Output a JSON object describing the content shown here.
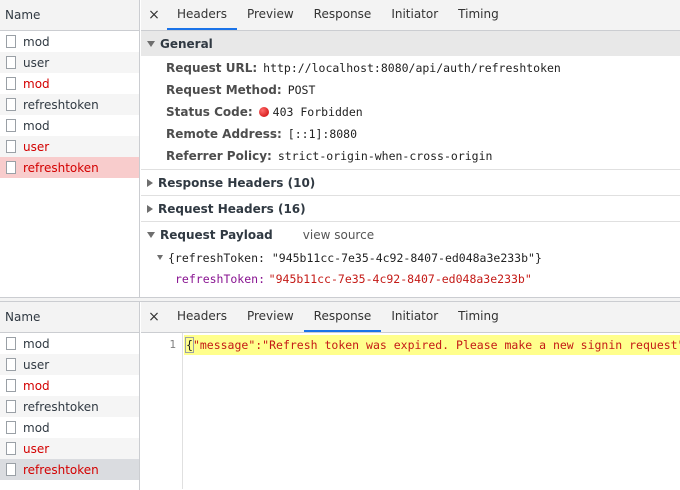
{
  "name_header": "Name",
  "requests": [
    {
      "name": "mod",
      "status": "ok"
    },
    {
      "name": "user",
      "status": "ok"
    },
    {
      "name": "mod",
      "status": "error"
    },
    {
      "name": "refreshtoken",
      "status": "ok"
    },
    {
      "name": "mod",
      "status": "ok"
    },
    {
      "name": "user",
      "status": "error"
    },
    {
      "name": "refreshtoken",
      "status": "error"
    }
  ],
  "tabs": {
    "close": "×",
    "headers": "Headers",
    "preview": "Preview",
    "response": "Response",
    "initiator": "Initiator",
    "timing": "Timing"
  },
  "top_pane": {
    "active_tab": "Headers",
    "general": {
      "title": "General",
      "request_url_label": "Request URL:",
      "request_url": "http://localhost:8080/api/auth/refreshtoken",
      "request_method_label": "Request Method:",
      "request_method": "POST",
      "status_code_label": "Status Code:",
      "status_code": "403 Forbidden",
      "remote_address_label": "Remote Address:",
      "remote_address": "[::1]:8080",
      "referrer_policy_label": "Referrer Policy:",
      "referrer_policy": "strict-origin-when-cross-origin"
    },
    "response_headers": "Response Headers (10)",
    "request_headers": "Request Headers (16)",
    "request_payload": "Request Payload",
    "view_source": "view source",
    "payload_summary": "{refreshToken: \"945b11cc-7e35-4c92-8407-ed048a3e233b\"}",
    "payload_key": "refreshToken:",
    "payload_value": "\"945b11cc-7e35-4c92-8407-ed048a3e233b\""
  },
  "bottom_pane": {
    "active_tab": "Response",
    "line_number": "1",
    "response_open": "{",
    "response_body": "\"message\":\"Refresh token was expired. Please make a new signin request\"",
    "response_close": "}"
  },
  "colors": {
    "error_text": "#d30000",
    "selected_error_row": "#f8cccc",
    "selected_gray_row": "#dadce0",
    "active_tab_underline": "#1a73e8",
    "code_highlight": "#ffff8c"
  }
}
